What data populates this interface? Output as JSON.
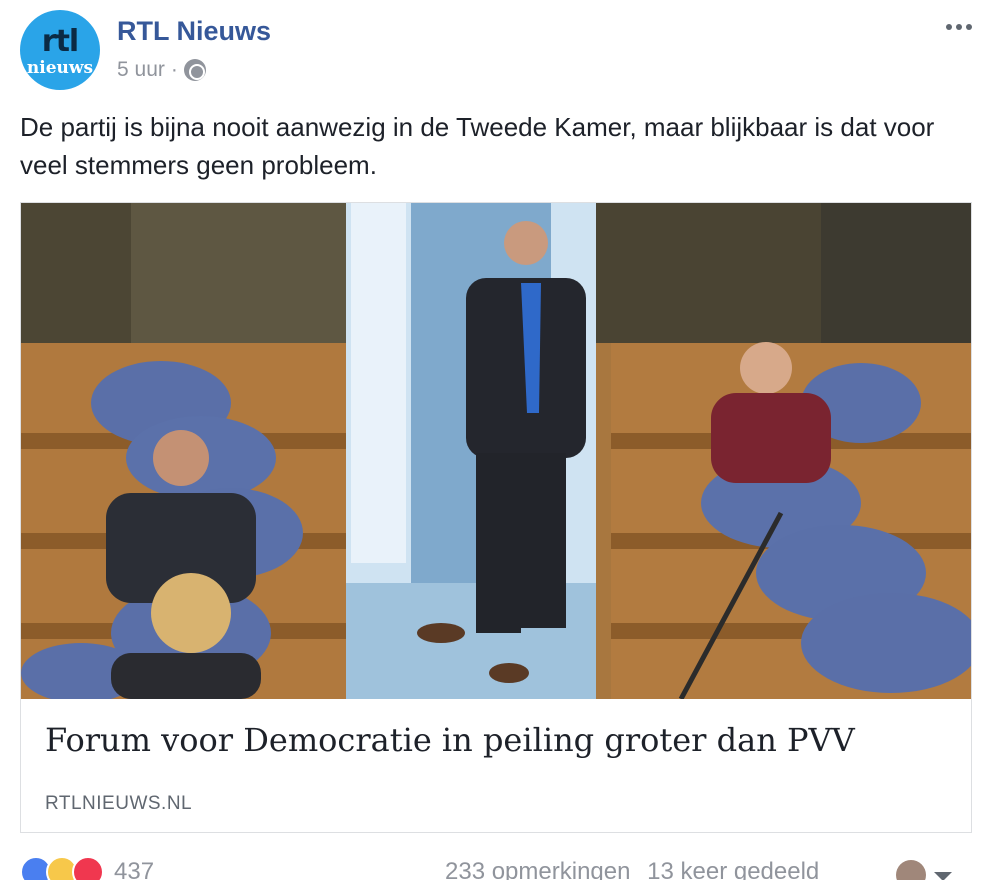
{
  "post": {
    "author": "RTL Nieuws",
    "avatar_text_top": "rtl",
    "avatar_text_bottom": "nieuws",
    "time": "5 uur",
    "separator": "·",
    "privacy_icon": "globe-icon",
    "text": "De partij is bijna nooit aanwezig in de Tweede Kamer, maar blijkbaar is dat voor veel stemmers geen probleem."
  },
  "link": {
    "title": "Forum voor Democratie in peiling groter dan PVV",
    "domain": "RTLNIEUWS.NL"
  },
  "footer": {
    "reaction_count": "437",
    "comments": "233 opmerkingen",
    "shares": "13 keer gedeeld"
  },
  "colors": {
    "brand_link": "#365899",
    "avatar_bg": "#2aa4e8",
    "muted": "#90949c"
  }
}
